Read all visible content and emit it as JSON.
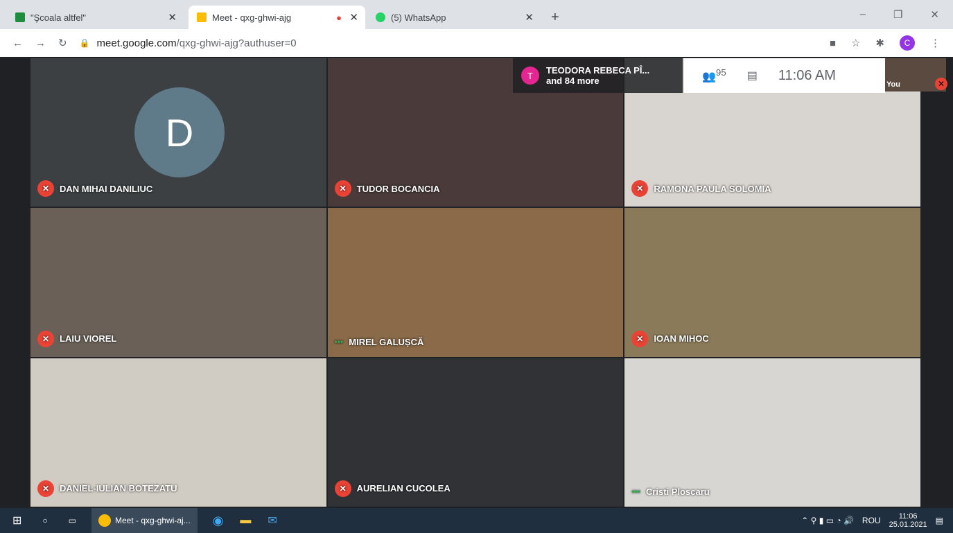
{
  "tabs": [
    {
      "title": "\"Şcoala altfel\""
    },
    {
      "title": "Meet - qxg-ghwi-ajg"
    },
    {
      "title": "(5) WhatsApp"
    }
  ],
  "url": {
    "host": "meet.google.com",
    "path": "/qxg-ghwi-ajg?authuser=0"
  },
  "profile": "C",
  "meet": {
    "presenter": "TEODORA REBECA PÎ...",
    "more": "and 84 more",
    "participants": "95",
    "time": "11:06 AM",
    "self": "You"
  },
  "tiles": [
    {
      "name": "DAN MIHAI DANILIUC",
      "muted": true,
      "avatar": "D"
    },
    {
      "name": "TUDOR BOCANCIA",
      "muted": true
    },
    {
      "name": "RAMONA PAULA SOLOMIA",
      "muted": true
    },
    {
      "name": "LAIU VIOREL",
      "muted": true
    },
    {
      "name": "MIREL GALUȘCĂ",
      "muted": false
    },
    {
      "name": "IOAN MIHOC",
      "muted": true
    },
    {
      "name": "DANIEL-IULIAN BOTEZATU",
      "muted": true
    },
    {
      "name": "AURELIAN CUCOLEA",
      "muted": true
    },
    {
      "name": "Cristi Ploscaru",
      "muted": false
    }
  ],
  "taskbar": {
    "app": "Meet - qxg-ghwi-aj...",
    "lang": "ROU",
    "time": "11:06",
    "date": "25.01.2021"
  }
}
